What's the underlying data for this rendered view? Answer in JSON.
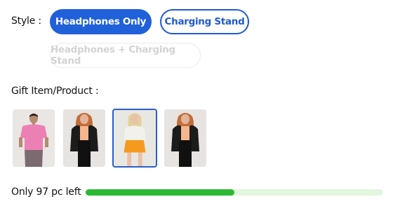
{
  "style_section": {
    "label": "Style :",
    "options": [
      {
        "label": "Headphones Only",
        "state": "selected"
      },
      {
        "label": "Charging Stand",
        "state": "available"
      },
      {
        "label": "Headphones + Charging Stand",
        "state": "disabled"
      }
    ]
  },
  "gift_section": {
    "label": "Gift Item/Product :",
    "thumbnails": [
      {
        "icon": "model-pink-tshirt-image",
        "selected": false
      },
      {
        "icon": "model-black-jacket-image",
        "selected": false
      },
      {
        "icon": "model-white-top-orange-skirt-image",
        "selected": true
      },
      {
        "icon": "model-black-jacket-image",
        "selected": false
      }
    ]
  },
  "stock": {
    "text": "Only 97 pc left",
    "remaining_fraction": 0.5
  },
  "colors": {
    "accent": "#2061d9",
    "progress": "#2bb934",
    "progress_track": "#e3f6df"
  }
}
